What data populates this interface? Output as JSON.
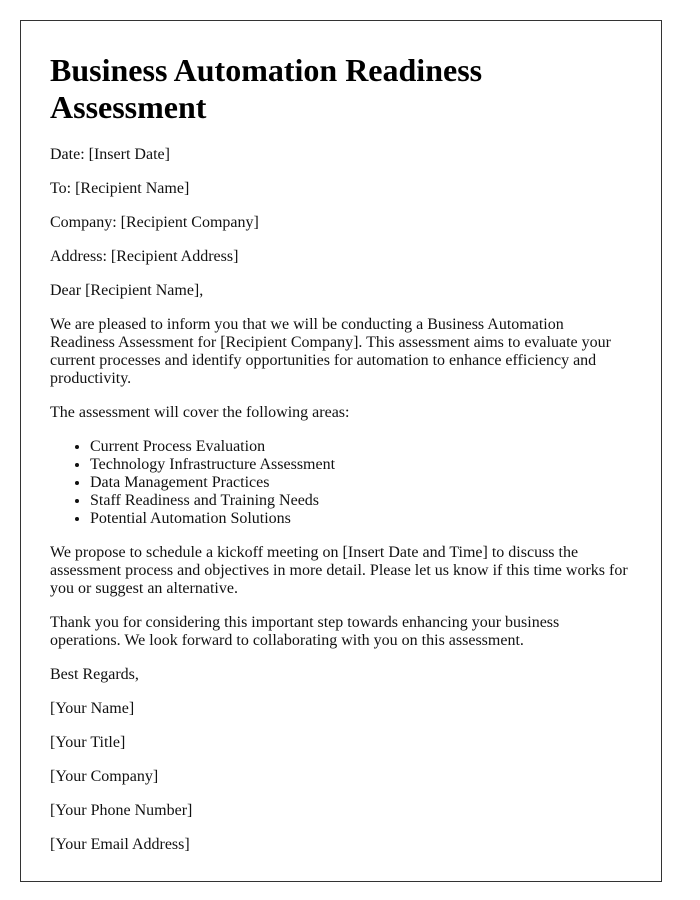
{
  "title": "Business Automation Readiness Assessment",
  "header_fields": {
    "date": "Date: [Insert Date]",
    "to": "To: [Recipient Name]",
    "company": "Company: [Recipient Company]",
    "address": "Address: [Recipient Address]"
  },
  "salutation": "Dear [Recipient Name],",
  "body": {
    "intro": "We are pleased to inform you that we will be conducting a Business Automation Readiness Assessment for [Recipient Company]. This assessment aims to evaluate your current processes and identify opportunities for automation to enhance efficiency and productivity.",
    "areas_intro": "The assessment will cover the following areas:",
    "areas": [
      "Current Process Evaluation",
      "Technology Infrastructure Assessment",
      "Data Management Practices",
      "Staff Readiness and Training Needs",
      "Potential Automation Solutions"
    ],
    "meeting": "We propose to schedule a kickoff meeting on [Insert Date and Time] to discuss the assessment process and objectives in more detail. Please let us know if this time works for you or suggest an alternative.",
    "closing_text": "Thank you for considering this important step towards enhancing your business operations. We look forward to collaborating with you on this assessment."
  },
  "signature": {
    "closing": "Best Regards,",
    "name": "[Your Name]",
    "title": "[Your Title]",
    "company": "[Your Company]",
    "phone": "[Your Phone Number]",
    "email": "[Your Email Address]"
  }
}
